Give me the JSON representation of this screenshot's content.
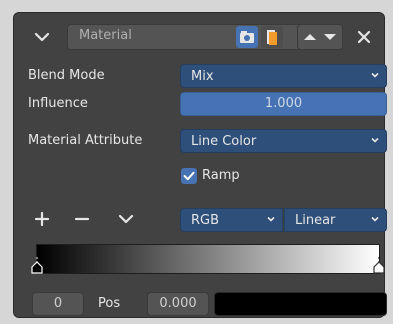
{
  "header": {
    "modifier_name": "Material"
  },
  "rows": {
    "blend_mode": {
      "label": "Blend Mode",
      "value": "Mix"
    },
    "influence": {
      "label": "Influence",
      "value": "1.000"
    },
    "material_attribute": {
      "label": "Material Attribute",
      "value": "Line Color"
    },
    "ramp": {
      "label": "Ramp",
      "checked": true
    }
  },
  "ramp_controls": {
    "color_mode": "RGB",
    "interpolation": "Linear"
  },
  "stop_editor": {
    "index": "0",
    "pos_label": "Pos",
    "pos_value": "0.000",
    "color": "#000000"
  },
  "colors": {
    "accent": "#4772b3",
    "field_blue": "#2d4f79",
    "panel": "#424242"
  }
}
